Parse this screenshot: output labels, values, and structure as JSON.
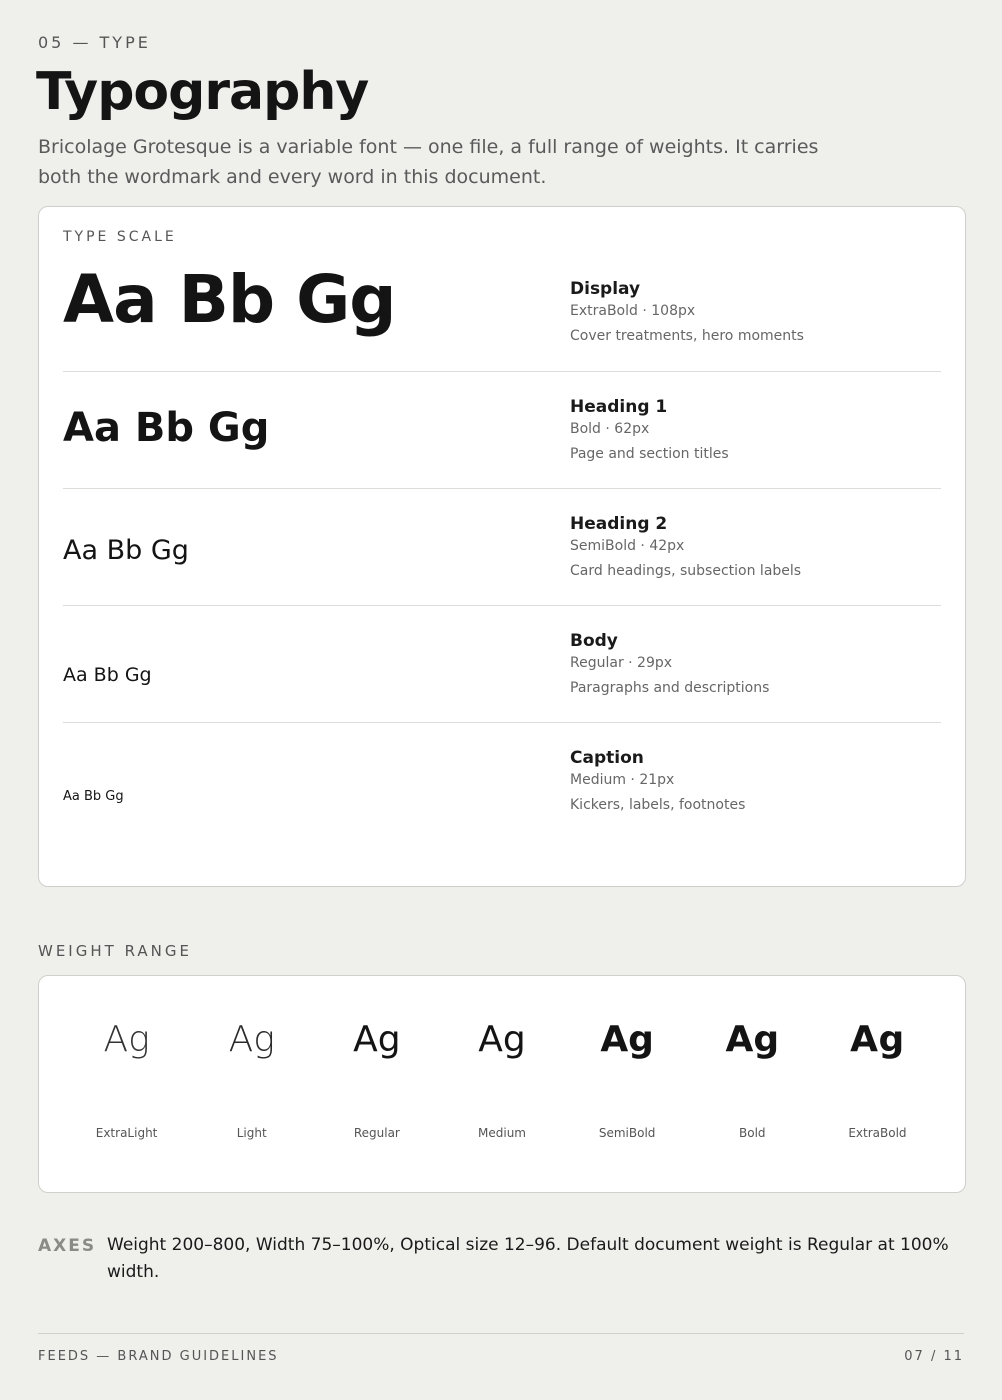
{
  "header": {
    "kicker": "05 — TYPE",
    "title": "Typography",
    "intro": "Bricolage Grotesque is a variable font — one file, a full range of weights. It carries both the wordmark and every word in this document."
  },
  "type_scale": {
    "label": "TYPE SCALE",
    "rows": [
      {
        "sample": "Aa Bb Gg",
        "name": "Display",
        "spec": "ExtraBold · 108px",
        "use": "Cover treatments, hero moments"
      },
      {
        "sample": "Aa Bb Gg",
        "name": "Heading 1",
        "spec": "Bold · 62px",
        "use": "Page and section titles"
      },
      {
        "sample": "Aa Bb Gg",
        "name": "Heading 2",
        "spec": "SemiBold · 42px",
        "use": "Card headings, subsection labels"
      },
      {
        "sample": "Aa Bb Gg",
        "name": "Body",
        "spec": "Regular · 29px",
        "use": "Paragraphs and descriptions"
      },
      {
        "sample": "Aa Bb Gg",
        "name": "Caption",
        "spec": "Medium · 21px",
        "use": "Kickers, labels, footnotes"
      }
    ]
  },
  "weight_range": {
    "label": "WEIGHT RANGE",
    "items": [
      {
        "glyph": "Ag",
        "name": "ExtraLight"
      },
      {
        "glyph": "Ag",
        "name": "Light"
      },
      {
        "glyph": "Ag",
        "name": "Regular"
      },
      {
        "glyph": "Ag",
        "name": "Medium"
      },
      {
        "glyph": "Ag",
        "name": "SemiBold"
      },
      {
        "glyph": "Ag",
        "name": "Bold"
      },
      {
        "glyph": "Ag",
        "name": "ExtraBold"
      }
    ]
  },
  "axes": {
    "label": "AXES",
    "text": "Weight 200–800, Width 75–100%, Optical size 12–96. Default document weight is Regular at 100% width."
  },
  "footer": {
    "left": "FEEDS — BRAND GUIDELINES",
    "right": "07 / 11"
  }
}
